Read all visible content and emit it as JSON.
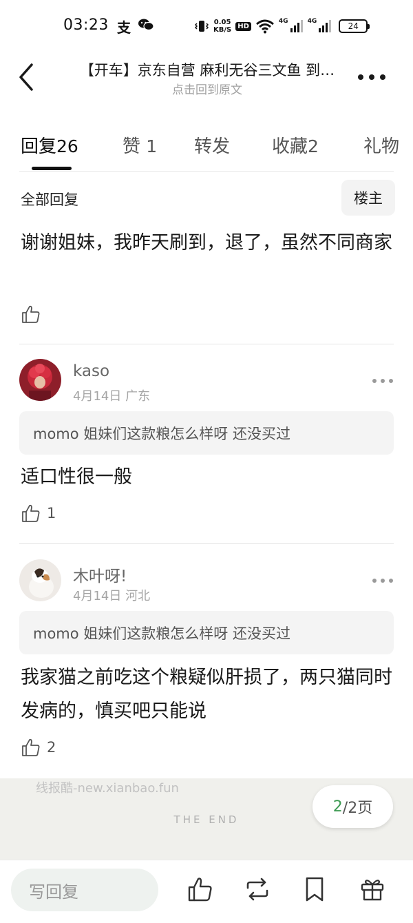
{
  "status_bar": {
    "time": "03:23",
    "app_icon_1": "支",
    "net_speed_value": "0.05",
    "net_speed_unit": "KB/S",
    "hd_badge": "HD",
    "signal_1": "4G",
    "signal_2": "4G",
    "battery": "24"
  },
  "header": {
    "title": "【开车】京东自营 麻利无谷三文鱼 到…",
    "subtitle": "点击回到原文"
  },
  "tabs": [
    {
      "label": "回复",
      "count": "26"
    },
    {
      "label": "赞",
      "count": "1"
    },
    {
      "label": "转发",
      "count": ""
    },
    {
      "label": "收藏",
      "count": "2"
    },
    {
      "label": "礼物",
      "count": ""
    }
  ],
  "filter": {
    "all_replies": "全部回复",
    "op_only": "楼主"
  },
  "comments": [
    {
      "text": "谢谢姐妹，我昨天刷到，退了，虽然不同商家",
      "likes": ""
    },
    {
      "username": "kaso",
      "date": "4月14日",
      "location": "广东",
      "quote": "momo 姐妹们这款粮怎么样呀 还没买过",
      "text": "适口性很一般",
      "likes": "1"
    },
    {
      "username": "木叶呀!",
      "date": "4月14日",
      "location": "河北",
      "quote": "momo 姐妹们这款粮怎么样呀 还没买过",
      "text": "我家猫之前吃这个粮疑似肝损了，两只猫同时发病的，慎买吧只能说",
      "likes": "2"
    }
  ],
  "end": {
    "watermark": "线报酷-new.xianbao.fun",
    "the_end": "THE END",
    "page_current": "2",
    "page_total": "/2页"
  },
  "bottom_bar": {
    "reply_placeholder": "写回复",
    "icons": [
      "thumbs-up-icon",
      "repost-icon",
      "bookmark-icon",
      "gift-icon"
    ]
  },
  "colors": {
    "accent_green": "#3c9a52",
    "text_primary": "#1a1a1a",
    "text_muted": "#a5a5a5",
    "quote_bg": "#f4f4f4",
    "reply_input_bg": "#eef2ef"
  }
}
